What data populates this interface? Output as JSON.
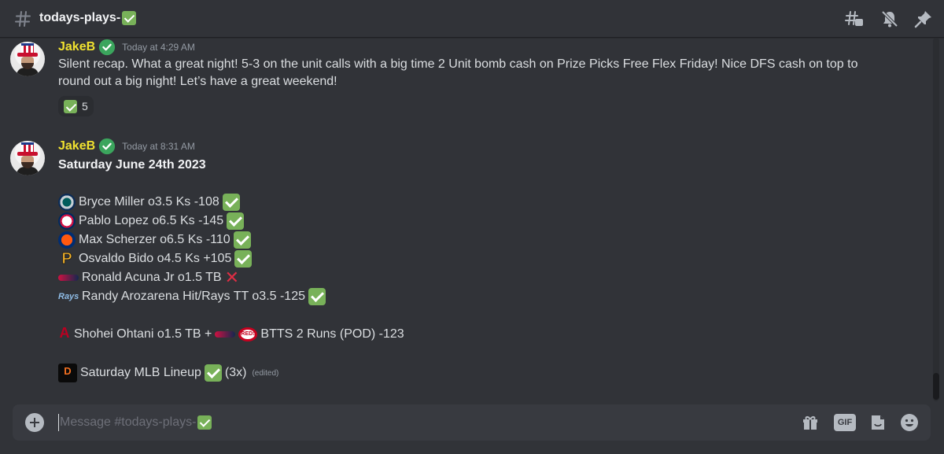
{
  "header": {
    "channel_name": "todays-plays-",
    "icons": [
      "hash-icon",
      "threads-icon",
      "mute-icon",
      "pin-icon"
    ]
  },
  "messages": [
    {
      "author": "JakeB",
      "timestamp": "Today at 4:29 AM",
      "lines": [
        "Silent recap. What a great night! 5-3 on the unit calls with a big time 2 Unit bomb cash on Prize Picks Free Flex Friday! Nice DFS cash on top to",
        "round out a big night! Let’s have a great weekend!"
      ],
      "reaction": {
        "count": "5"
      }
    },
    {
      "author": "JakeB",
      "timestamp": "Today at 8:31 AM",
      "title": "Saturday June 24th 2023",
      "picks": [
        {
          "team_icon": "mariners-logo",
          "text": "Bryce Miller o3.5 Ks -108",
          "result": "check"
        },
        {
          "team_icon": "twins-logo",
          "text": "Pablo Lopez o6.5 Ks -145",
          "result": "check"
        },
        {
          "team_icon": "mets-logo",
          "text": "Max Scherzer o6.5 Ks -110",
          "result": "check"
        },
        {
          "team_icon": "pirates-logo",
          "text": "Osvaldo Bido o4.5 Ks +105",
          "result": "check"
        },
        {
          "team_icon": "braves-logo",
          "text": "Ronald Acuna Jr o1.5 TB",
          "result": "cross"
        },
        {
          "team_icon": "rays-logo",
          "text": "Randy Arozarena Hit/Rays TT o3.5 -125",
          "result": "check"
        }
      ],
      "potd": {
        "text1": "Shohei Ohtani o1.5 TB +",
        "text2": "BTTS 2 Runs (POD) -123"
      },
      "lineup": {
        "text": "Saturday MLB Lineup",
        "suffix": "(3x)",
        "edited": "(edited)"
      }
    }
  ],
  "composer": {
    "placeholder": "Message #todays-plays-",
    "icons": [
      "plus-icon",
      "gift-icon",
      "gif-icon",
      "sticker-icon",
      "emoji-icon"
    ],
    "gif_label": "GIF"
  },
  "colors": {
    "background": "#313338",
    "author": "#f0e130",
    "check": "#78b159",
    "cross": "#dd2e44"
  }
}
